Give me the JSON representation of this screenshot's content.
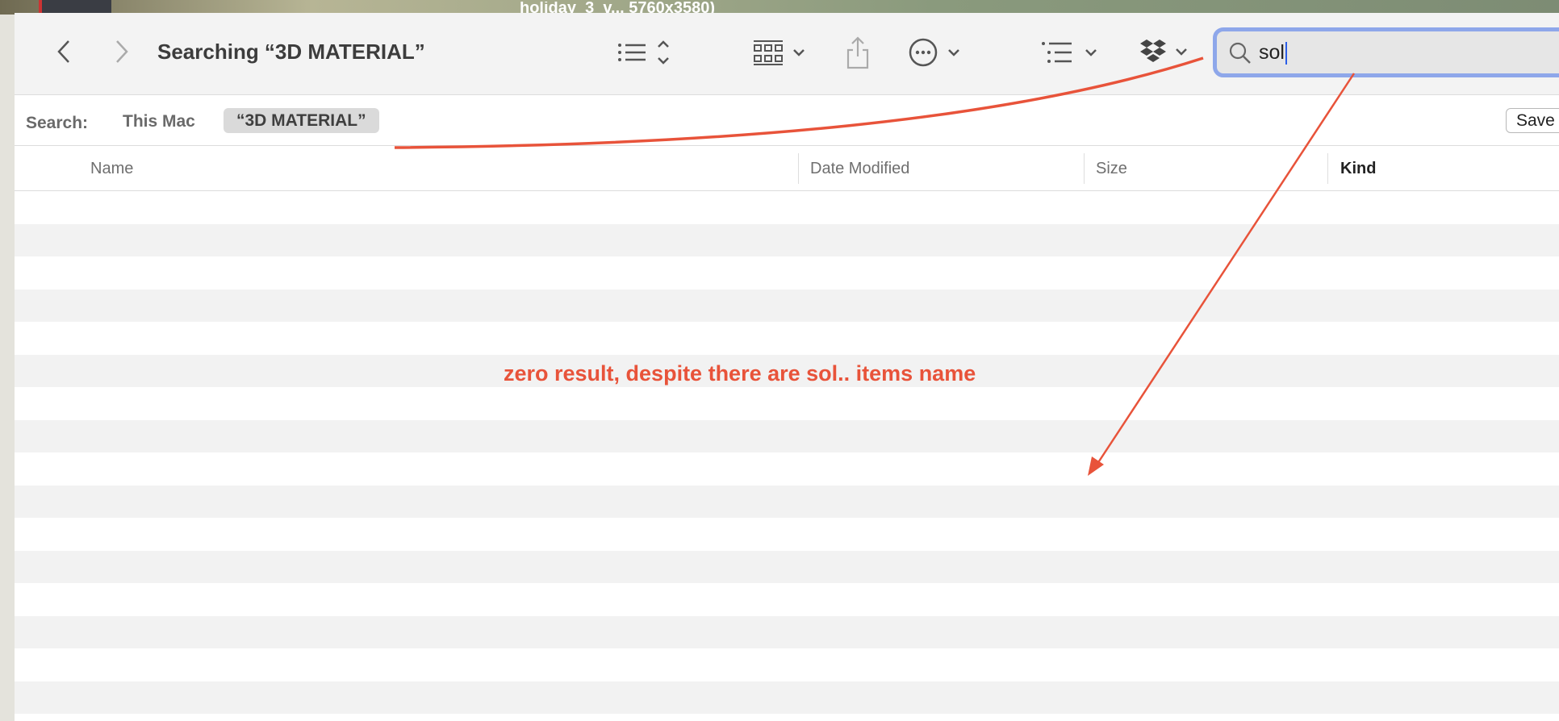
{
  "desktop": {
    "background_text": "holiday_3_v... 5760x3580)"
  },
  "toolbar": {
    "title": "Searching “3D MATERIAL”",
    "back_icon": "chevron-left-icon",
    "forward_icon": "chevron-right-icon",
    "icons": [
      "list-view-icon",
      "gallery-grid-icon",
      "share-icon",
      "more-actions-icon",
      "group-by-icon",
      "dropbox-icon"
    ]
  },
  "search": {
    "value": "sol",
    "icon": "magnifier-icon"
  },
  "scope_bar": {
    "label": "Search:",
    "this_mac": "This Mac",
    "folder": "“3D MATERIAL”",
    "save": "Save"
  },
  "columns": [
    "Name",
    "Date Modified",
    "Size",
    "Kind"
  ],
  "annotation": {
    "text": "zero result, despite there are sol.. items name",
    "color": "#e8533a"
  },
  "accent": "#8ea7ea"
}
